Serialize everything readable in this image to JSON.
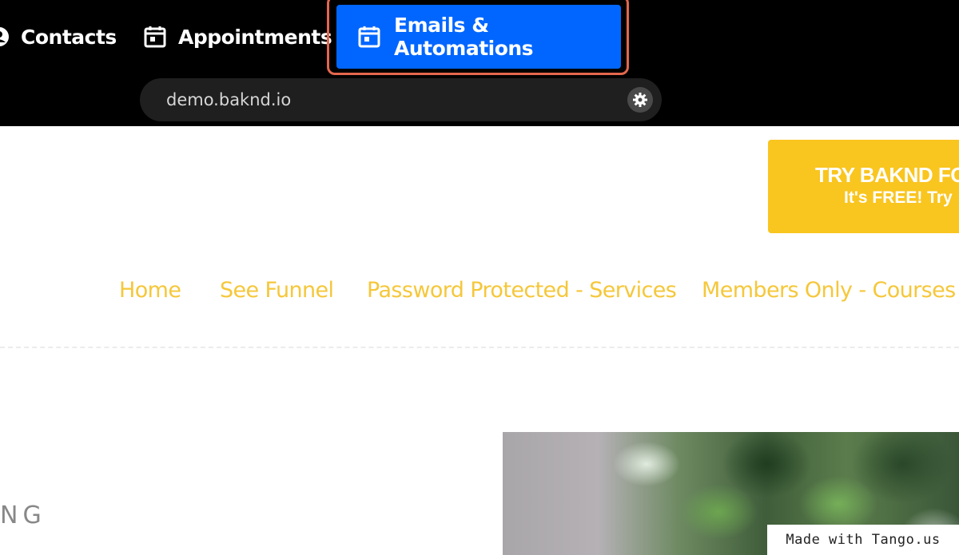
{
  "app_nav": {
    "items": [
      {
        "label": "Contacts",
        "icon": "contacts-icon"
      },
      {
        "label": "Appointments",
        "icon": "calendar-icon"
      },
      {
        "label": "Emails & Automations",
        "icon": "calendar-icon",
        "active": true
      }
    ]
  },
  "urlbar": {
    "url": "demo.baknd.io",
    "settings_icon": "gear-icon"
  },
  "cta": {
    "line1": "TRY BAKND FO",
    "line2": "It's FREE! Try"
  },
  "site_nav": {
    "items": [
      "Home",
      "See Funnel",
      "Password Protected - Services",
      "Members Only - Courses"
    ]
  },
  "hero": {
    "partial_heading": "NG"
  },
  "watermark": {
    "label": "Made with Tango.us"
  },
  "colors": {
    "topbar": "#000000",
    "active_tab": "#0066ff",
    "highlight": "#e4674e",
    "accent_yellow": "#f9c51f",
    "nav_text": "#f5c73a"
  }
}
